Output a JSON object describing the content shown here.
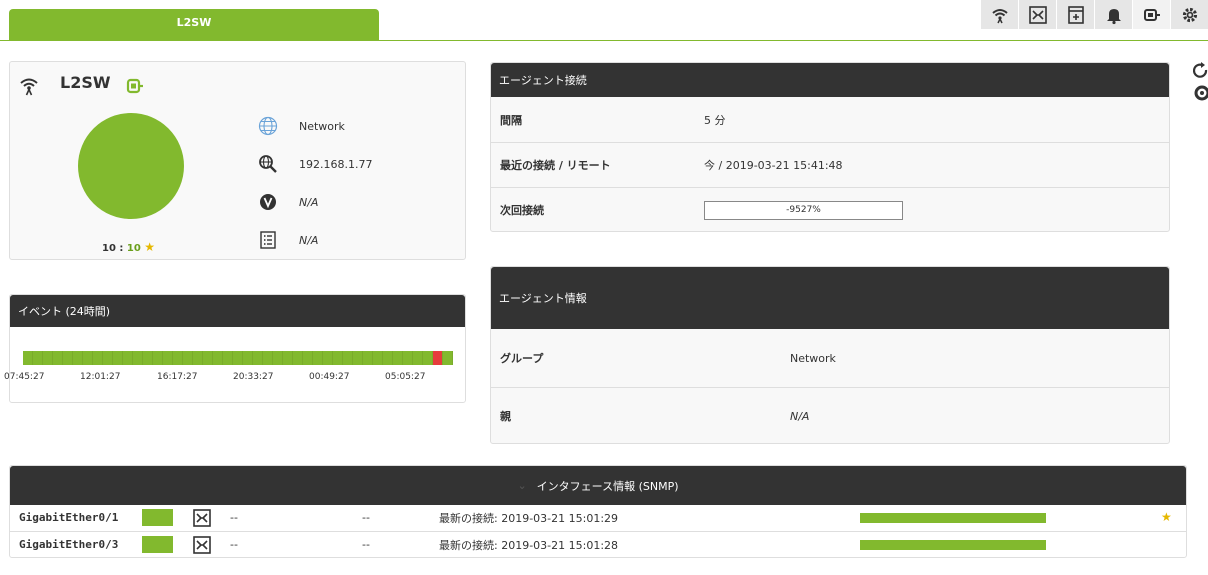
{
  "tab": {
    "title": "L2SW"
  },
  "toolbar": {
    "icons": [
      "wifi-icon",
      "interface-icon",
      "archive-icon",
      "bell-icon",
      "agent-status-icon",
      "gear-icon"
    ]
  },
  "agent": {
    "name": "L2SW",
    "group": "Network",
    "ip": "192.168.1.77",
    "version": "N/A",
    "description": "N/A",
    "score_left": "10",
    "score_right": "10",
    "status_color": "#82b92e"
  },
  "events": {
    "title": "イベント (24時間)",
    "times": [
      "07:45:27",
      "12:01:27",
      "16:17:27",
      "20:33:27",
      "00:49:27",
      "05:05:27"
    ],
    "red_segment_index": 41,
    "segment_count": 43
  },
  "connection": {
    "title": "エージェント接続",
    "interval_label": "間隔",
    "interval_value": "5 分",
    "last_label": "最近の接続 / リモート",
    "last_value": "今 / 2019-03-21 15:41:48",
    "next_label": "次回接続",
    "next_value": "-9527%"
  },
  "agent_info": {
    "title": "エージェント情報",
    "group_label": "グループ",
    "group_value": "Network",
    "parent_label": "親",
    "parent_value": "N/A"
  },
  "interfaces": {
    "title": "インタフェース情報 (SNMP)",
    "rows": [
      {
        "name": "GigabitEther0/1",
        "col1": "--",
        "col2": "--",
        "last": "最新の接続: 2019-03-21 15:01:29",
        "star": "★"
      },
      {
        "name": "GigabitEther0/3",
        "col1": "--",
        "col2": "--",
        "last": "最新の接続: 2019-03-21 15:01:28",
        "star": ""
      }
    ]
  },
  "colors": {
    "accent": "#82b92e",
    "dark": "#333333",
    "alert": "#e63c3c",
    "star": "#e6b800"
  }
}
